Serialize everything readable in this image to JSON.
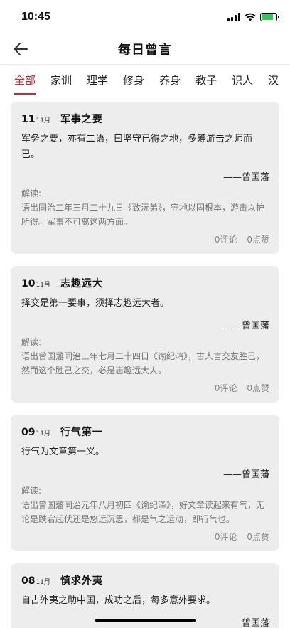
{
  "status": {
    "time": "10:45"
  },
  "header": {
    "title": "每日曾言"
  },
  "tabs": [
    {
      "label": "全部"
    },
    {
      "label": "家训"
    },
    {
      "label": "理学"
    },
    {
      "label": "修身"
    },
    {
      "label": "养身"
    },
    {
      "label": "教子"
    },
    {
      "label": "识人"
    },
    {
      "label": "汉"
    }
  ],
  "cards": [
    {
      "day": "11",
      "month": "11月",
      "title": "军事之要",
      "quote": "军务之要，亦有二语，曰坚守已得之地，多筹游击之师而已。",
      "author": "——曾国藩",
      "interp_label": "解读:",
      "interp": "语出同治二年三月二十九日《致沅弟》，守地以固根本，游击以护所得。军事不可离这两方面。",
      "comments": "0评论",
      "likes": "0点赞"
    },
    {
      "day": "10",
      "month": "11月",
      "title": "志趣远大",
      "quote": "择交是第一要事，须择志趣远大者。",
      "author": "——曾国藩",
      "interp_label": "解读:",
      "interp": "语出曾国藩同治三年七月二十四日《谕纪鸿》，古人言交友胜己，然而这个胜己之交，必是志趣远大人。",
      "comments": "0评论",
      "likes": "0点赞"
    },
    {
      "day": "09",
      "month": "11月",
      "title": "行气第一",
      "quote": "行气为文章第一义。",
      "author": "——曾国藩",
      "interp_label": "解读:",
      "interp": "语出曾国藩同治元年八月初四《谕纪泽》，好文章读起来有气，无论是跌宕起伏还是悠远沉思，都是气之运动，即行气也。",
      "comments": "0评论",
      "likes": "0点赞"
    },
    {
      "day": "08",
      "month": "11月",
      "title": "慎求外夷",
      "quote": "自古外夷之助中国，成功之后，每多意外要求。",
      "author": "曾国藩"
    }
  ]
}
